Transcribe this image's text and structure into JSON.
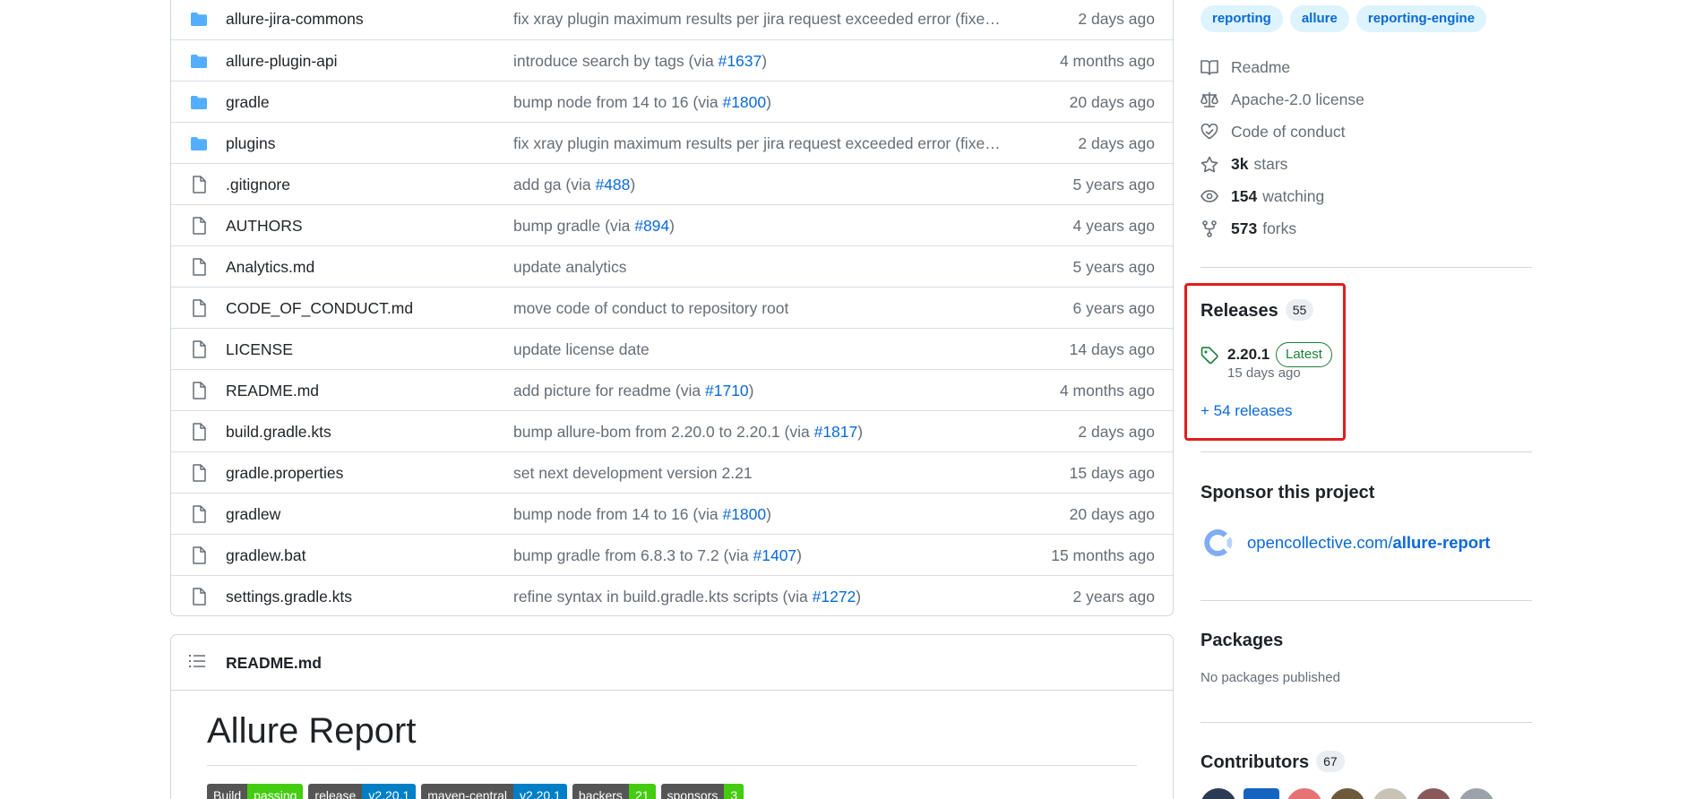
{
  "files": [
    {
      "type": "dir",
      "name": "allure-jira-commons",
      "message": "fix xray plugin maximum results per jira request exceeded error (fixes …",
      "pr": "",
      "age": "2 days ago"
    },
    {
      "type": "dir",
      "name": "allure-plugin-api",
      "message": "introduce search by tags (via ",
      "pr": "#1637",
      "suffix": ")",
      "age": "4 months ago"
    },
    {
      "type": "dir",
      "name": "gradle",
      "message": "bump node from 14 to 16 (via ",
      "pr": "#1800",
      "suffix": ")",
      "age": "20 days ago"
    },
    {
      "type": "dir",
      "name": "plugins",
      "message": "fix xray plugin maximum results per jira request exceeded error (fixes …",
      "pr": "",
      "age": "2 days ago"
    },
    {
      "type": "file",
      "name": ".gitignore",
      "message": "add ga (via ",
      "pr": "#488",
      "suffix": ")",
      "age": "5 years ago"
    },
    {
      "type": "file",
      "name": "AUTHORS",
      "message": "bump gradle (via ",
      "pr": "#894",
      "suffix": ")",
      "age": "4 years ago"
    },
    {
      "type": "file",
      "name": "Analytics.md",
      "message": "update analytics",
      "pr": "",
      "age": "5 years ago"
    },
    {
      "type": "file",
      "name": "CODE_OF_CONDUCT.md",
      "message": "move code of conduct to repository root",
      "pr": "",
      "age": "6 years ago"
    },
    {
      "type": "file",
      "name": "LICENSE",
      "message": "update license date",
      "pr": "",
      "age": "14 days ago"
    },
    {
      "type": "file",
      "name": "README.md",
      "message": "add picture for readme (via ",
      "pr": "#1710",
      "suffix": ")",
      "age": "4 months ago"
    },
    {
      "type": "file",
      "name": "build.gradle.kts",
      "message": "bump allure-bom from 2.20.0 to 2.20.1 (via ",
      "pr": "#1817",
      "suffix": ")",
      "age": "2 days ago"
    },
    {
      "type": "file",
      "name": "gradle.properties",
      "message": "set next development version 2.21",
      "pr": "",
      "age": "15 days ago"
    },
    {
      "type": "file",
      "name": "gradlew",
      "message": "bump node from 14 to 16 (via ",
      "pr": "#1800",
      "suffix": ")",
      "age": "20 days ago"
    },
    {
      "type": "file",
      "name": "gradlew.bat",
      "message": "bump gradle from 6.8.3 to 7.2 (via ",
      "pr": "#1407",
      "suffix": ")",
      "age": "15 months ago"
    },
    {
      "type": "file",
      "name": "settings.gradle.kts",
      "message": "refine syntax in build.gradle.kts scripts (via ",
      "pr": "#1272",
      "suffix": ")",
      "age": "2 years ago"
    }
  ],
  "readme": {
    "header": "README.md",
    "title": "Allure Report",
    "badges": [
      {
        "left": "Build",
        "right": "passing",
        "color": "green"
      },
      {
        "left": "release",
        "right": "v2.20.1",
        "color": "blue"
      },
      {
        "left": "maven-central",
        "right": "v2.20.1",
        "color": "blue"
      },
      {
        "left": "backers",
        "right": "21",
        "color": "green"
      },
      {
        "left": "sponsors",
        "right": "3",
        "color": "green"
      }
    ]
  },
  "sidebar": {
    "topics": [
      "reporting",
      "allure",
      "reporting-engine"
    ],
    "readme_label": "Readme",
    "license_label": "Apache-2.0 license",
    "conduct_label": "Code of conduct",
    "stars_count": "3k",
    "stars_label": "stars",
    "watching_count": "154",
    "watching_label": "watching",
    "forks_count": "573",
    "forks_label": "forks",
    "releases": {
      "title": "Releases",
      "count": "55",
      "latest_version": "2.20.1",
      "latest_label": "Latest",
      "latest_date": "15 days ago",
      "more_link": "+ 54 releases"
    },
    "sponsor": {
      "title": "Sponsor this project",
      "host": "opencollective.com/",
      "path": "allure-report"
    },
    "packages": {
      "title": "Packages",
      "note": "No packages published"
    },
    "contributors": {
      "title": "Contributors",
      "count": "67"
    }
  },
  "colors": {
    "link": "#0969da",
    "folder": "#54aeff",
    "highlight": "#e11d1d",
    "latest": "#1a7f37"
  }
}
